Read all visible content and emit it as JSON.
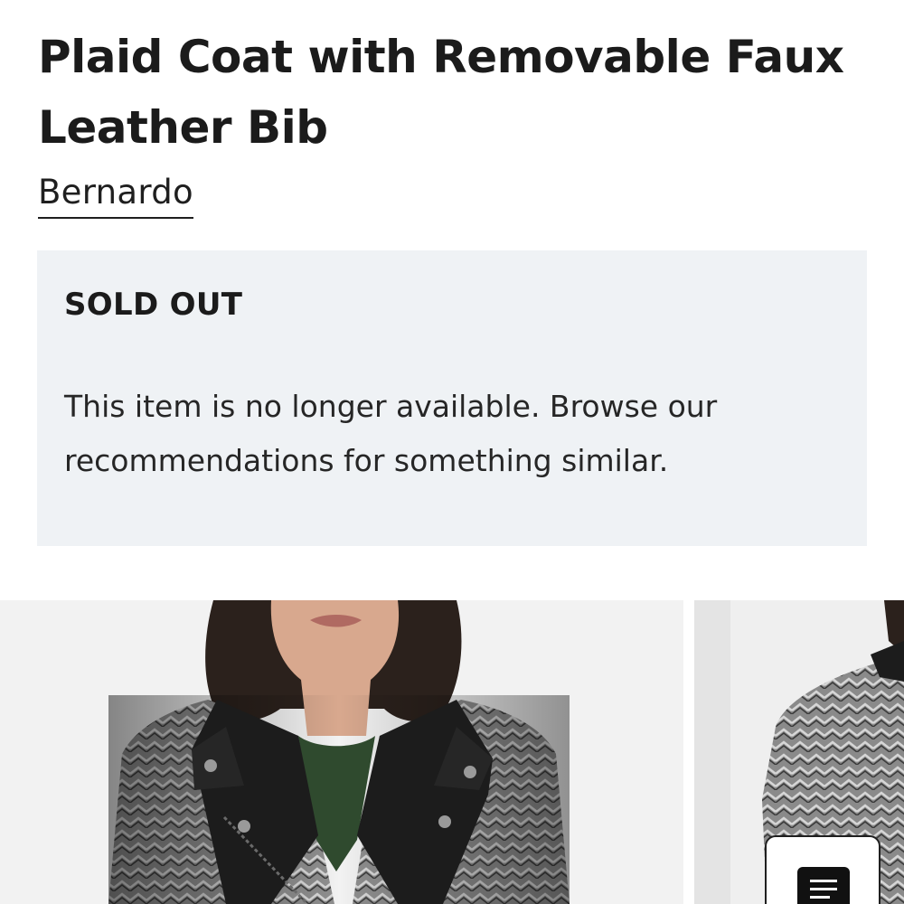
{
  "product": {
    "title": "Plaid Coat with Removable Faux Leather Bib",
    "brand": "Bernardo"
  },
  "availability": {
    "status": "SOLD OUT",
    "message": "This item is no longer available. Browse our recommendations for something similar."
  },
  "gallery": {
    "images": [
      {
        "name": "product-image-front"
      },
      {
        "name": "product-image-side"
      }
    ]
  },
  "colors": {
    "panel_background": "#eff2f5",
    "text": "#1b1b1b"
  },
  "icons": {
    "floating_button": "list-icon"
  }
}
